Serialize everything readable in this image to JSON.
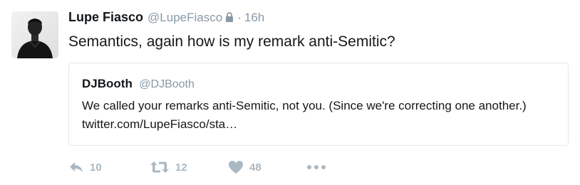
{
  "tweet": {
    "author": {
      "fullname": "Lupe Fiasco",
      "username": "@LupeFiasco",
      "protected_icon": "lock-icon"
    },
    "separator": "·",
    "time": "16h",
    "text": "Semantics, again how is my remark anti-Semitic?",
    "quoted": {
      "fullname": "DJBooth",
      "username": "@DJBooth",
      "text": "We called your remarks anti-Semitic, not you. (Since we're correcting one another.) twitter.com/LupeFiasco/sta…"
    },
    "actions": {
      "reply": {
        "icon": "reply-icon",
        "count": "10"
      },
      "retweet": {
        "icon": "retweet-icon",
        "count": "12"
      },
      "like": {
        "icon": "heart-icon",
        "count": "48"
      },
      "more": {
        "icon": "more-dots-icon"
      }
    },
    "colors": {
      "text": "#14171a",
      "muted": "#8899a6",
      "action_gray": "#aab8c2",
      "border": "#e1e8ed"
    }
  }
}
